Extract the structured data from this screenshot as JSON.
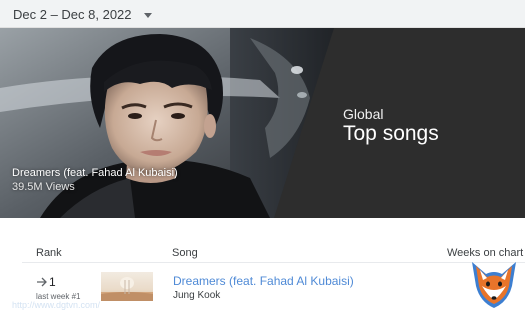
{
  "date_range": {
    "label": "Dec 2 – Dec 8, 2022",
    "icon": "chevron-down-icon"
  },
  "hero": {
    "region": "Global",
    "title": "Top songs",
    "featured_song": "Dreamers (feat. Fahad Al Kubaisi)",
    "featured_views": "39.5M Views",
    "background_color": "#2b2b2b"
  },
  "table": {
    "columns": [
      "Rank",
      "Song",
      "Weeks on chart"
    ],
    "rows": [
      {
        "rank": "1",
        "rank_icon": "arrow-right-icon",
        "last_week": "last week #1",
        "title": "Dreamers (feat. Fahad Al Kubaisi)",
        "artist": "Jung Kook",
        "thumbnail_icon": "album-art"
      }
    ]
  },
  "watermark": "http://www.dgtvn.com/",
  "colors": {
    "link": "#4f8ad6",
    "topbar": "#f1f3f4",
    "logo_orange": "#e8742a",
    "logo_blue": "#3d7fd1"
  }
}
